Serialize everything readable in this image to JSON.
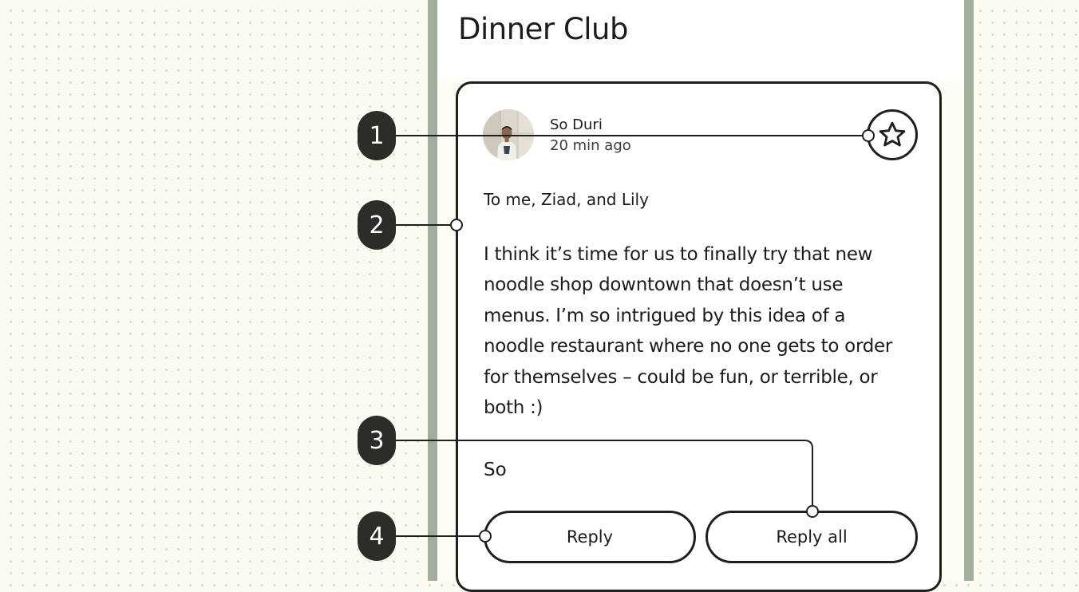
{
  "app": {
    "title": "Dinner Club"
  },
  "message": {
    "sender": "So Duri",
    "timestamp": "20 min ago",
    "recipients": "To me, Ziad, and Lily",
    "body": "I think it’s time for us to finally try that new\nnoodle shop downtown that doesn’t use\nmenus. I’m so intrigued by this idea of a\nnoodle restaurant where no one gets to order\nfor themselves – could be fun, or terrible, or\nboth :)",
    "signature": "So",
    "star_icon": "star-outline-icon"
  },
  "actions": {
    "reply_label": "Reply",
    "reply_all_label": "Reply all"
  },
  "annotations": [
    {
      "label": "1"
    },
    {
      "label": "2"
    },
    {
      "label": "3"
    },
    {
      "label": "4"
    }
  ],
  "colors": {
    "page_background": "#fbfaf1",
    "device_frame": "#a2ae9b",
    "screen_background": "#fdfcf5",
    "outline": "#1f1f1d",
    "badge": "#2b2d29"
  }
}
